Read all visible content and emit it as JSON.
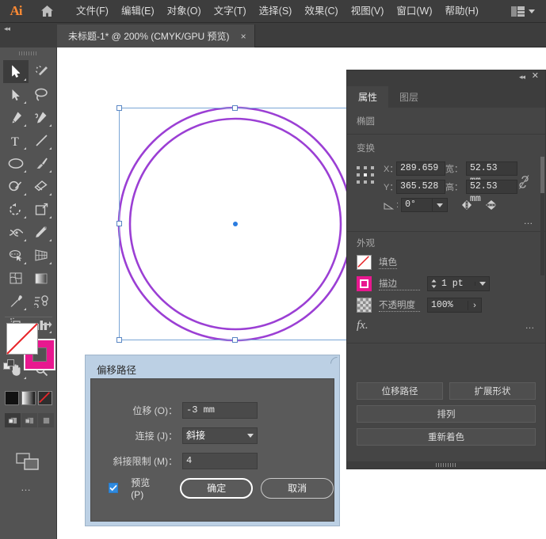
{
  "app": {
    "logo": "Ai",
    "home_icon": "home-icon"
  },
  "menubar": {
    "items": [
      {
        "label": "文件(F)"
      },
      {
        "label": "编辑(E)"
      },
      {
        "label": "对象(O)"
      },
      {
        "label": "文字(T)"
      },
      {
        "label": "选择(S)"
      },
      {
        "label": "效果(C)"
      },
      {
        "label": "视图(V)"
      },
      {
        "label": "窗口(W)"
      },
      {
        "label": "帮助(H)"
      }
    ],
    "workspace_icon": "workspace-switcher-icon",
    "workspace_chevron": "chevron-down-icon"
  },
  "tabbar": {
    "collapse_icon": "collapse-panel-icon",
    "document": {
      "title": "未标题-1* @ 200% (CMYK/GPU 预览)",
      "close": "×"
    }
  },
  "toolbar": {
    "tools": [
      {
        "name": "selection-tool",
        "selected": true
      },
      {
        "name": "magic-wand-tool",
        "selected": false
      },
      {
        "name": "direct-selection-tool",
        "selected": false
      },
      {
        "name": "lasso-tool",
        "selected": false
      },
      {
        "name": "pen-tool",
        "selected": false
      },
      {
        "name": "curvature-tool",
        "selected": false
      },
      {
        "name": "type-tool",
        "selected": false
      },
      {
        "name": "line-segment-tool",
        "selected": false
      },
      {
        "name": "ellipse-tool",
        "selected": false
      },
      {
        "name": "paintbrush-tool",
        "selected": false
      },
      {
        "name": "shaper-tool",
        "selected": false
      },
      {
        "name": "eraser-tool",
        "selected": false
      },
      {
        "name": "rotate-tool",
        "selected": false
      },
      {
        "name": "scale-tool",
        "selected": false
      },
      {
        "name": "width-tool",
        "selected": false
      },
      {
        "name": "free-transform-tool",
        "selected": false
      },
      {
        "name": "shape-builder-tool",
        "selected": false
      },
      {
        "name": "perspective-grid-tool",
        "selected": false
      },
      {
        "name": "mesh-tool",
        "selected": false
      },
      {
        "name": "gradient-tool",
        "selected": false
      },
      {
        "name": "eyedropper-tool",
        "selected": false
      },
      {
        "name": "blend-tool",
        "selected": false
      },
      {
        "name": "symbol-sprayer-tool",
        "selected": false
      },
      {
        "name": "column-graph-tool",
        "selected": false
      },
      {
        "name": "artboard-tool",
        "selected": false
      },
      {
        "name": "slice-tool",
        "selected": false
      },
      {
        "name": "hand-tool",
        "selected": false
      },
      {
        "name": "zoom-tool",
        "selected": false
      }
    ],
    "fill_swatch": "fill-none-swatch",
    "stroke_swatch": "stroke-magenta-swatch",
    "swap_icon": "swap-fill-stroke-icon",
    "default_icon": "default-fill-stroke-icon",
    "color_modes": [
      "color-swatch-button",
      "gradient-swatch-button",
      "none-swatch-button"
    ],
    "draw_modes": [
      "draw-normal-button",
      "draw-behind-button",
      "draw-inside-button"
    ],
    "screen_mode": "change-screen-mode-button",
    "more_tools": "…"
  },
  "canvas": {
    "shape": "ellipse",
    "stroke_color": "#9b3fd4",
    "selection_color": "#7aa5d6",
    "center_point_color": "#2b7ce0"
  },
  "properties_panel": {
    "collapse_icon": "collapse-panel-icon",
    "close_icon": "close-panel-icon",
    "tabs": [
      {
        "label": "属性",
        "active": true
      },
      {
        "label": "图层",
        "active": false
      }
    ],
    "object_type": "椭圆",
    "transform": {
      "heading": "变换",
      "reference_point_icon": "reference-point-grid",
      "x_label": "X：",
      "x_value": "289.659",
      "y_label": "Y：",
      "y_value": "365.528",
      "w_label": "宽：",
      "w_value": "52.53 mm",
      "h_label": "高：",
      "h_value": "52.53 mm",
      "angle_label": "angle-icon",
      "angle_value": "0°",
      "angle_chevron": "chevron-down-icon",
      "link_icon": "unlink-proportions-icon",
      "flip_h_icon": "flip-horizontal-icon",
      "flip_v_icon": "flip-vertical-icon",
      "more_icon": "…"
    },
    "appearance": {
      "heading": "外观",
      "fill_label": "填色",
      "fill_swatch": "fill-none-swatch",
      "stroke_label": "描边",
      "stroke_swatch": "stroke-magenta-swatch",
      "stroke_weight": "1 pt",
      "stroke_stepper_icon": "stepper-icon",
      "stroke_chevron": "chevron-down-icon",
      "opacity_label": "不透明度",
      "opacity_value": "100%",
      "opacity_arrow": "›",
      "opacity_swatch": "transparency-checker-swatch",
      "fx_label": "fx.",
      "more_icon": "…"
    },
    "actions": {
      "offset_path": "位移路径",
      "expand_shape": "扩展形状",
      "arrange": "排列",
      "recolor": "重新着色"
    },
    "resize_grip": "panel-resize-grip"
  },
  "dialog": {
    "title": "偏移路径",
    "fields": {
      "offset_label": "位移 (O)：",
      "offset_value": "-3 mm",
      "join_label": "连接 (J)：",
      "join_value": "斜接",
      "join_chevron": "chevron-down-icon",
      "miter_label": "斜接限制 (M)：",
      "miter_value": "4"
    },
    "preview_label": "预览 (P)",
    "preview_checked": true,
    "ok_label": "确定",
    "cancel_label": "取消",
    "resize_grip": "dialog-resize-grip"
  }
}
